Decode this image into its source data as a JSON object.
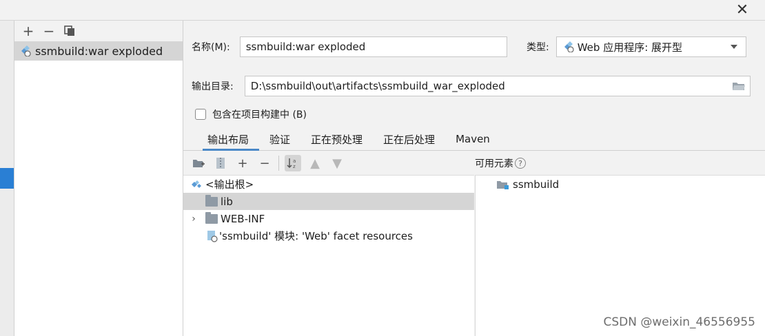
{
  "window": {
    "close_glyph": "✕"
  },
  "artifact_list": {
    "toolbar": {
      "add": "+",
      "remove": "−",
      "copy": "⧉"
    },
    "items": [
      {
        "label": "ssmbuild:war exploded"
      }
    ]
  },
  "form": {
    "name_label": "名称(M):",
    "name_value": "ssmbuild:war exploded",
    "type_label": "类型:",
    "type_value": "Web 应用程序: 展开型",
    "output_label": "输出目录:",
    "output_value": "D:\\ssmbuild\\out\\artifacts\\ssmbuild_war_exploded",
    "include_label": "包含在项目构建中 (B)",
    "include_checked": false
  },
  "tabs": [
    {
      "label": "输出布局",
      "active": true
    },
    {
      "label": "验证",
      "active": false
    },
    {
      "label": "正在预处理",
      "active": false
    },
    {
      "label": "正在后处理",
      "active": false
    },
    {
      "label": "Maven",
      "active": false
    }
  ],
  "layout_toolbar": {
    "add": "+",
    "remove": "−"
  },
  "available": {
    "header": "可用元素",
    "help": "?",
    "items": [
      {
        "label": "ssmbuild"
      }
    ]
  },
  "tree": {
    "root": "<输出根>",
    "items": [
      {
        "label": "lib",
        "selected": true
      },
      {
        "label": "WEB-INF",
        "expandable": true
      },
      {
        "label": "'ssmbuild' 模块: 'Web' facet resources"
      }
    ]
  },
  "watermark": "CSDN @weixin_46556955",
  "colors": {
    "accent": "#4a88c7",
    "selection": "#d5d5d5",
    "strip_accent": "#2a7fd4"
  }
}
